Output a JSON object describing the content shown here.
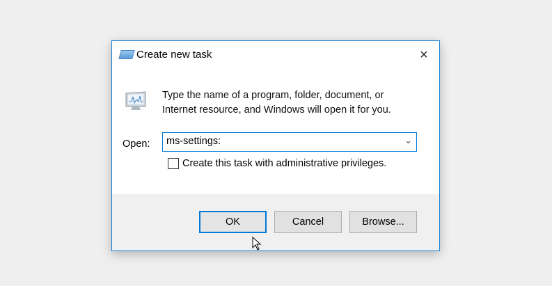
{
  "dialog": {
    "title": "Create new task",
    "close_icon": "×",
    "description_line1": "Type the name of a program, folder, document, or",
    "description_line2": "Internet resource, and Windows will open it for you.",
    "open_label": "Open:",
    "open_value": "ms-settings:",
    "checkbox_label": "Create this task with administrative privileges.",
    "checkbox_checked": false,
    "buttons": {
      "ok": "OK",
      "cancel": "Cancel",
      "browse": "Browse..."
    }
  },
  "colors": {
    "accent": "#0078d7",
    "footer": "#f0f0f0"
  }
}
